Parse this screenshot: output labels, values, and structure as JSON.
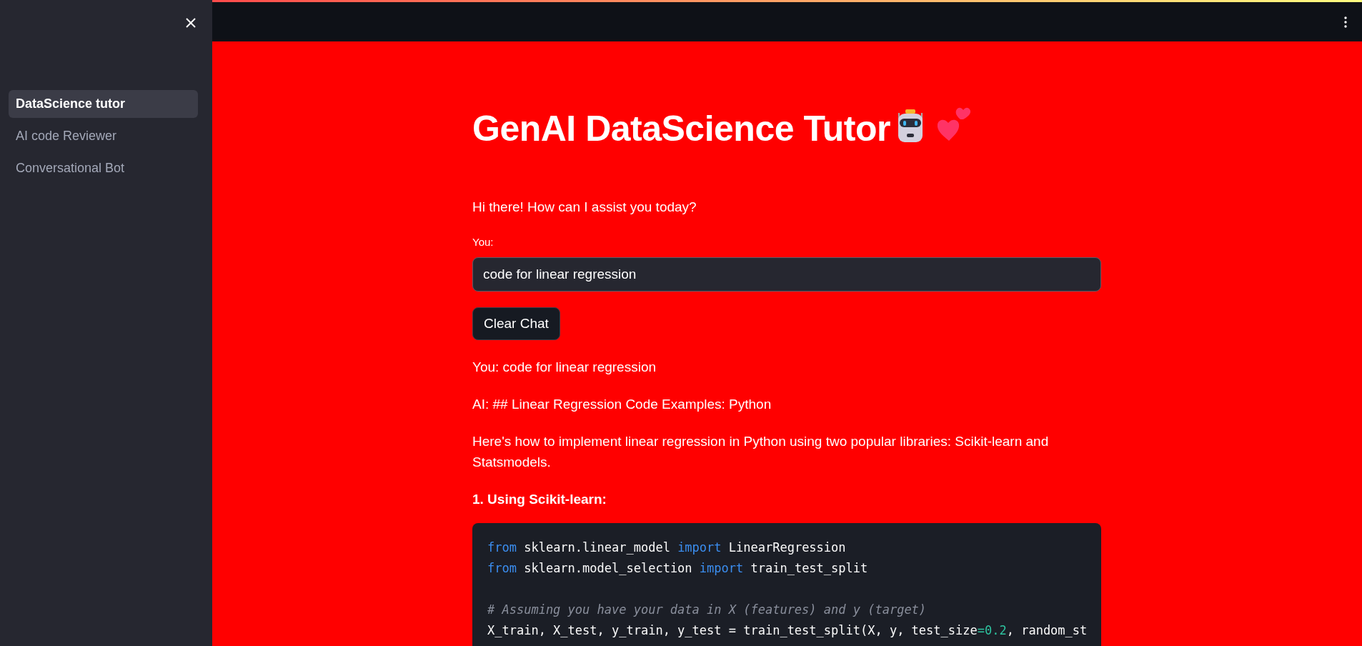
{
  "sidebar": {
    "items": [
      {
        "label": "DataScience tutor",
        "selected": true
      },
      {
        "label": "AI code Reviewer",
        "selected": false
      },
      {
        "label": "Conversational Bot",
        "selected": false
      }
    ]
  },
  "main": {
    "title": "GenAI DataScience Tutor",
    "greeting": "Hi there! How can I assist you today?",
    "input": {
      "label": "You:",
      "value": "code for linear regression"
    },
    "clear_button": "Clear Chat",
    "messages": [
      {
        "kind": "text",
        "text": "You: code for linear regression"
      },
      {
        "kind": "text",
        "text": "AI: ## Linear Regression Code Examples: Python"
      },
      {
        "kind": "text",
        "text": "Here's how to implement linear regression in Python using two popular libraries: Scikit-learn and Statsmodels."
      },
      {
        "kind": "heading",
        "text": "1. Using Scikit-learn:"
      },
      {
        "kind": "code",
        "lines": [
          {
            "kind": "code",
            "tokens": [
              {
                "kind": "keyword",
                "text": "from"
              },
              {
                "kind": "plain",
                "text": " sklearn.linear_model "
              },
              {
                "kind": "keyword",
                "text": "import"
              },
              {
                "kind": "plain",
                "text": " LinearRegression"
              }
            ]
          },
          {
            "kind": "code",
            "tokens": [
              {
                "kind": "keyword",
                "text": "from"
              },
              {
                "kind": "plain",
                "text": " sklearn.model_selection "
              },
              {
                "kind": "keyword",
                "text": "import"
              },
              {
                "kind": "plain",
                "text": " train_test_split"
              }
            ]
          },
          {
            "kind": "blank"
          },
          {
            "kind": "code",
            "tokens": [
              {
                "kind": "comment",
                "text": "# Assuming you have your data in X (features) and y (target)"
              }
            ]
          },
          {
            "kind": "code",
            "tokens": [
              {
                "kind": "plain",
                "text": "X_train, X_test, y_train, y_test = train_test_split(X, y, test_size"
              },
              {
                "kind": "number",
                "text": "=0.2"
              },
              {
                "kind": "plain",
                "text": ", random_st"
              }
            ]
          }
        ]
      }
    ]
  }
}
